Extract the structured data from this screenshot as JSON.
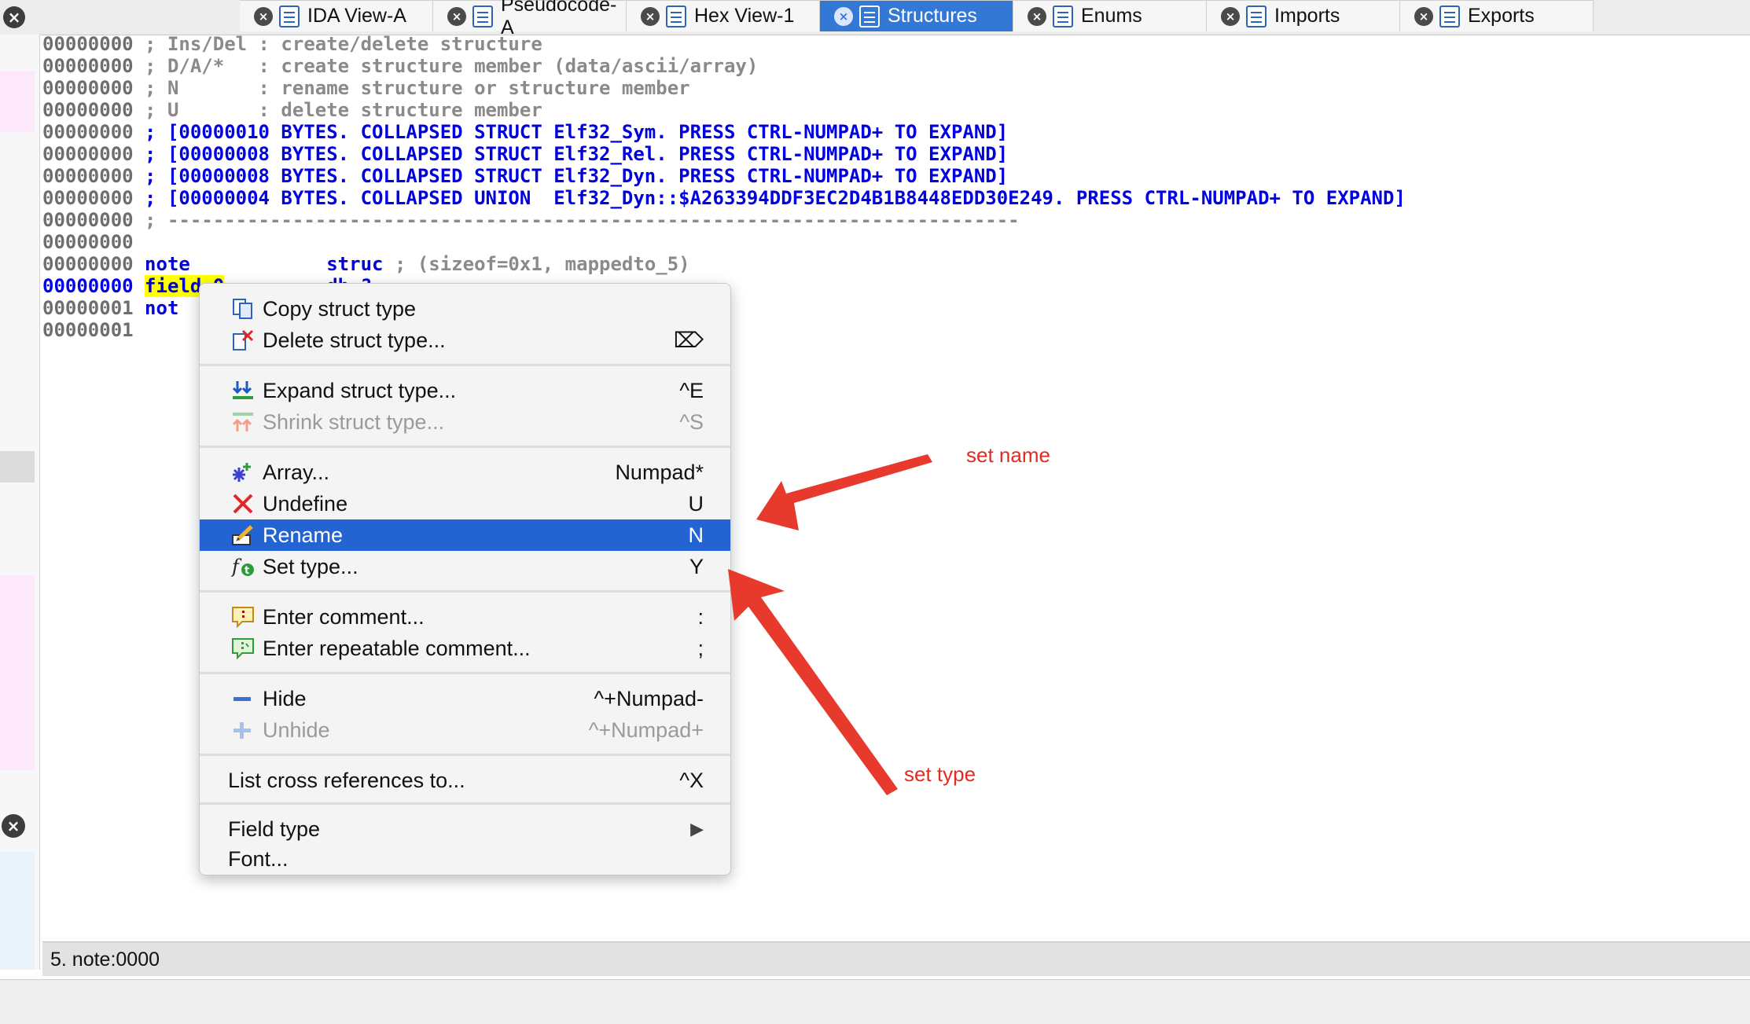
{
  "tabs": [
    {
      "label": "IDA View-A",
      "icon": "listing-icon",
      "active": false
    },
    {
      "label": "Pseudocode-A",
      "icon": "pseudocode-icon",
      "active": false
    },
    {
      "label": "Hex View-1",
      "icon": "hex-icon",
      "active": false
    },
    {
      "label": "Structures",
      "icon": "structures-icon",
      "active": true
    },
    {
      "label": "Enums",
      "icon": "enums-icon",
      "active": false
    },
    {
      "label": "Imports",
      "icon": "imports-icon",
      "active": false
    },
    {
      "label": "Exports",
      "icon": "exports-icon",
      "active": false
    }
  ],
  "code": {
    "lines": [
      {
        "addr": "00000000",
        "text": " ; Ins/Del : create/delete structure",
        "kind": "comment"
      },
      {
        "addr": "00000000",
        "text": " ; D/A/*   : create structure member (data/ascii/array)",
        "kind": "comment"
      },
      {
        "addr": "00000000",
        "text": " ; N       : rename structure or structure member",
        "kind": "comment"
      },
      {
        "addr": "00000000",
        "text": " ; U       : delete structure member",
        "kind": "comment"
      },
      {
        "addr": "00000000",
        "text": " ; [00000010 BYTES. COLLAPSED STRUCT Elf32_Sym. PRESS CTRL-NUMPAD+ TO EXPAND]",
        "kind": "collapsed"
      },
      {
        "addr": "00000000",
        "text": " ; [00000008 BYTES. COLLAPSED STRUCT Elf32_Rel. PRESS CTRL-NUMPAD+ TO EXPAND]",
        "kind": "collapsed"
      },
      {
        "addr": "00000000",
        "text": " ; [00000008 BYTES. COLLAPSED STRUCT Elf32_Dyn. PRESS CTRL-NUMPAD+ TO EXPAND]",
        "kind": "collapsed"
      },
      {
        "addr": "00000000",
        "text": " ; [00000004 BYTES. COLLAPSED UNION  Elf32_Dyn::$A263394DDF3EC2D4B1B8448EDD30E249. PRESS CTRL-NUMPAD+ TO EXPAND]",
        "kind": "collapsed"
      },
      {
        "addr": "00000000",
        "text": " ; ---------------------------------------------------------------------------",
        "kind": "comment"
      },
      {
        "addr": "00000000",
        "text": "",
        "kind": "plain"
      },
      {
        "addr": "00000000",
        "text": "",
        "kind": "struct"
      },
      {
        "addr": "00000000",
        "text": "",
        "kind": "field"
      },
      {
        "addr": "00000001",
        "text": " not",
        "kind": "ident"
      },
      {
        "addr": "00000001",
        "text": "",
        "kind": "plain"
      }
    ],
    "struct_name": "note",
    "struct_kw": "struc",
    "struct_comment": "; (sizeof=0x1, mappedto_5)",
    "field_name": "field_0",
    "field_type": "db ?"
  },
  "menu": {
    "items": [
      {
        "label": "Copy struct type",
        "shortcut": "",
        "icon": "copy-struct-icon"
      },
      {
        "label": "Delete struct type...",
        "shortcut": "⌦",
        "icon": "delete-struct-icon"
      },
      {
        "label": "Expand struct type...",
        "shortcut": "^E",
        "icon": "expand-struct-icon"
      },
      {
        "label": "Shrink struct type...",
        "shortcut": "^S",
        "icon": "shrink-struct-icon",
        "disabled": true
      },
      {
        "label": "Array...",
        "shortcut": "Numpad*",
        "icon": "array-icon"
      },
      {
        "label": "Undefine",
        "shortcut": "U",
        "icon": "undefine-icon"
      },
      {
        "label": "Rename",
        "shortcut": "N",
        "icon": "rename-icon",
        "active": true
      },
      {
        "label": "Set type...",
        "shortcut": "Y",
        "icon": "set-type-icon"
      },
      {
        "label": "Enter comment...",
        "shortcut": ":",
        "icon": "comment-icon"
      },
      {
        "label": "Enter repeatable comment...",
        "shortcut": ";",
        "icon": "repeatable-comment-icon"
      },
      {
        "label": "Hide",
        "shortcut": "^+Numpad-",
        "icon": "hide-icon"
      },
      {
        "label": "Unhide",
        "shortcut": "^+Numpad+",
        "icon": "unhide-icon",
        "disabled": true
      },
      {
        "label": "List cross references to...",
        "shortcut": "^X"
      },
      {
        "label": "Field type",
        "shortcut": "▶"
      },
      {
        "label": "Font...",
        "shortcut": ""
      }
    ]
  },
  "status": {
    "text": "5. note:0000"
  },
  "annotations": {
    "set_name": "set name",
    "set_type": "set type"
  },
  "colors": {
    "active_tab": "#3478d6",
    "menu_highlight": "#2364d2",
    "annotation": "#e02b20",
    "code_blue": "#0000e0",
    "field_highlight": "#ffff00"
  }
}
